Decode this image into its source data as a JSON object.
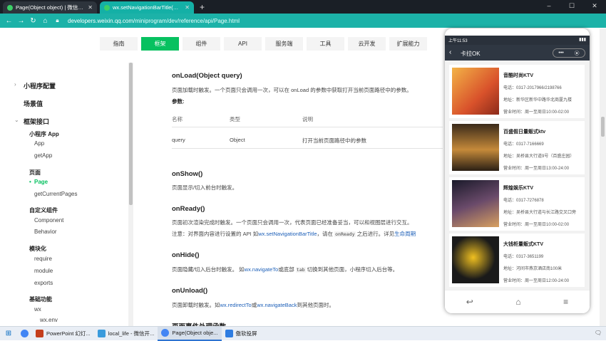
{
  "browser": {
    "tabs": [
      {
        "title": "Page(Object object) | 微信开放...",
        "active": false
      },
      {
        "title": "wx.setNavigationBarTitle(Obj...",
        "active": true
      }
    ],
    "url_prefix": "developers.weixin.qq.com",
    "url_path": "/miniprogram/dev/reference/api/Page.html",
    "window_controls": [
      "–",
      "☐",
      "✕"
    ]
  },
  "topnav": [
    {
      "label": "指南",
      "active": false
    },
    {
      "label": "框架",
      "active": true
    },
    {
      "label": "组件",
      "active": false
    },
    {
      "label": "API",
      "active": false
    },
    {
      "label": "服务端",
      "active": false
    },
    {
      "label": "工具",
      "active": false
    },
    {
      "label": "云开发",
      "active": false
    },
    {
      "label": "扩展能力",
      "active": false
    }
  ],
  "sidebar": {
    "config": "小程序配置",
    "scene": "场景值",
    "framework_api": "框架接口",
    "app_group": "小程序 App",
    "app": "App",
    "getapp": "getApp",
    "page_group": "页面",
    "page": "Page",
    "getcurrentpages": "getCurrentPages",
    "custom_group": "自定义组件",
    "component": "Component",
    "behavior": "Behavior",
    "module_group": "模块化",
    "require": "require",
    "module": "module",
    "exports": "exports",
    "basic_group": "基础功能",
    "wx": "wx",
    "wxenv": "wx.env"
  },
  "doc": {
    "onload_title": "onLoad(Object query)",
    "onload_desc": "页面加载时触发。一个页面只会调用一次，可以在 onLoad 的参数中获取打开当前页面路径中的参数。",
    "params_label": "参数:",
    "table_headers": [
      "名称",
      "类型",
      "说明"
    ],
    "table_rows": [
      {
        "name": "query",
        "type": "Object",
        "desc": "打开当前页面路径中的参数"
      }
    ],
    "onshow_title": "onShow()",
    "onshow_desc": "页面显示/切入前台时触发。",
    "onready_title": "onReady()",
    "onready_desc": "页面初次渲染完成时触发。一个页面只会调用一次，代表页面已经准备妥当，可以和视图层进行交互。",
    "onready_note_a": "注意：对界面内容进行设置的 API 如",
    "onready_note_link": "wx.setNavigationBarTitle",
    "onready_note_b": "，请在",
    "onready_note_code": "onReady",
    "onready_note_c": "之后进行。详见",
    "onready_note_link2": "生命周期",
    "onhide_title": "onHide()",
    "onhide_desc_a": "页面隐藏/切入后台时触发。 如",
    "onhide_link": "wx.navigateTo",
    "onhide_desc_b": "或底部",
    "onhide_code": "tab",
    "onhide_desc_c": "切换到其他页面，小程序切入后台等。",
    "onunload_title": "onUnload()",
    "onunload_desc_a": "页面卸载时触发。如",
    "onunload_link1": "wx.redirectTo",
    "onunload_desc_b": "或",
    "onunload_link2": "wx.navigateBack",
    "onunload_desc_c": "到其他页面时。",
    "next_title": "页面事件处理函数"
  },
  "phone": {
    "time": "上午11:53",
    "title": "卡拉OK",
    "capsule_more": "•••",
    "capsule_close": "⦿",
    "items": [
      {
        "name": "音酷时尚KTV",
        "phone": "电话：0317-2017966/2198766",
        "address": "地址：新华区新华中路华北商厦九楼",
        "hours": "营业时间：周一至周日10:00-02:00"
      },
      {
        "name": "百盛假日量贩式ktv",
        "phone": "电话：0317-7166669",
        "address": "地址：吴桥县大行道9号（百盛庄园）",
        "hours": "营业时间：周一至周日13:00-24:00"
      },
      {
        "name": "辉煌娱乐KTV",
        "phone": "电话：0317-7276878",
        "address": "地址：吴桥县大行道与长江路交叉口旁",
        "hours": "营业时间：周一至周日10:00-02:00"
      },
      {
        "name": "大钱柜量贩式KTV",
        "phone": "电话：0317-3651199",
        "address": "地址：河间市燕京酒店南100米",
        "hours": "营业时间：周一至周日12:00-24:00"
      }
    ]
  },
  "taskbar": {
    "items": [
      {
        "label": "PowerPoint 幻灯...",
        "active": false,
        "color": "#c43e1c"
      },
      {
        "label": "local_life - 微信开...",
        "active": false,
        "color": "#3a9bdc"
      },
      {
        "label": "Page(Object obje...",
        "active": true,
        "color": "#4285f4"
      },
      {
        "label": "傲软投屏",
        "active": false,
        "color": "#2f7de1"
      }
    ]
  }
}
